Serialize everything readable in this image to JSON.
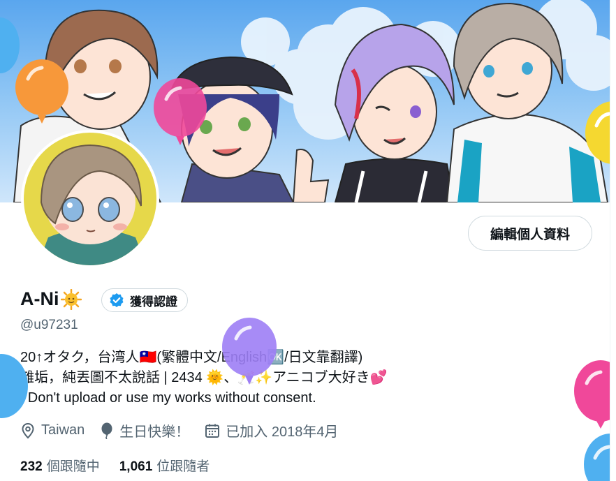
{
  "profile": {
    "display_name": "A-Ni",
    "verified_label": "獲得認證",
    "handle": "@u97231",
    "edit_button_label": "編輯個人資料",
    "bio": {
      "line1": "20↑オタク，台湾人🇹🇼(繁體中文/English🆗/日文靠翻譯)",
      "line2": "雜垢，純丟圖不太說話 | 2434 🌞、🥂✨アニコブ大好き💕",
      "line3": "| Don't upload or use my works without consent."
    },
    "location": "Taiwan",
    "birthday": "生日快樂！",
    "joined": "已加入 2018年4月",
    "following_count": "232",
    "following_label": "個跟隨中",
    "followers_count": "1,061",
    "followers_label": "位跟隨者"
  },
  "icons": {
    "name_emoji": "sun-emoji-icon",
    "verified": "verified-badge-icon",
    "location": "location-pin-icon",
    "birthday": "balloon-icon",
    "joined": "calendar-icon"
  },
  "colors": {
    "verified_blue": "#1d9bf0",
    "secondary_text": "#536471",
    "balloon_orange": "#f7983a",
    "balloon_pink": "#f0489a",
    "balloon_purple": "#9d7ef5",
    "balloon_blue": "#4fb0f0",
    "balloon_yellow": "#f5d830"
  }
}
